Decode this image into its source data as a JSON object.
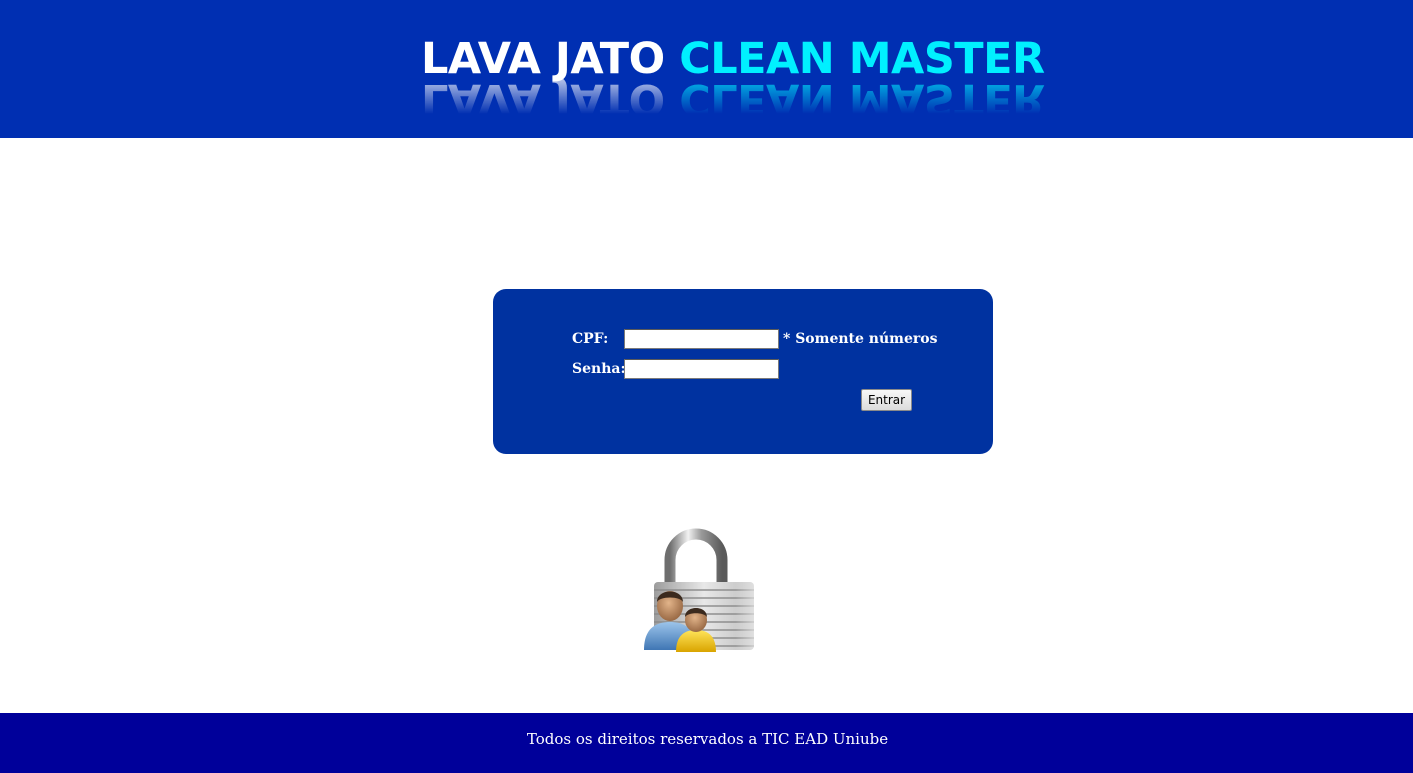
{
  "header": {
    "logo_word_1": "LAVA JATO",
    "logo_word_2": "CLEAN MASTER",
    "background_color": "#002fb2",
    "accent_color": "#00f0ff"
  },
  "login": {
    "cpf_label": "CPF:",
    "cpf_value": "",
    "cpf_hint": "* Somente números",
    "senha_label": "Senha:",
    "senha_value": "",
    "submit_label": "Entrar",
    "panel_color": "#0032a0"
  },
  "illustration": {
    "icon": "user-lock-icon"
  },
  "footer": {
    "text": "Todos os direitos reservados a TIC EAD Uniube",
    "background_color": "#00009a"
  }
}
